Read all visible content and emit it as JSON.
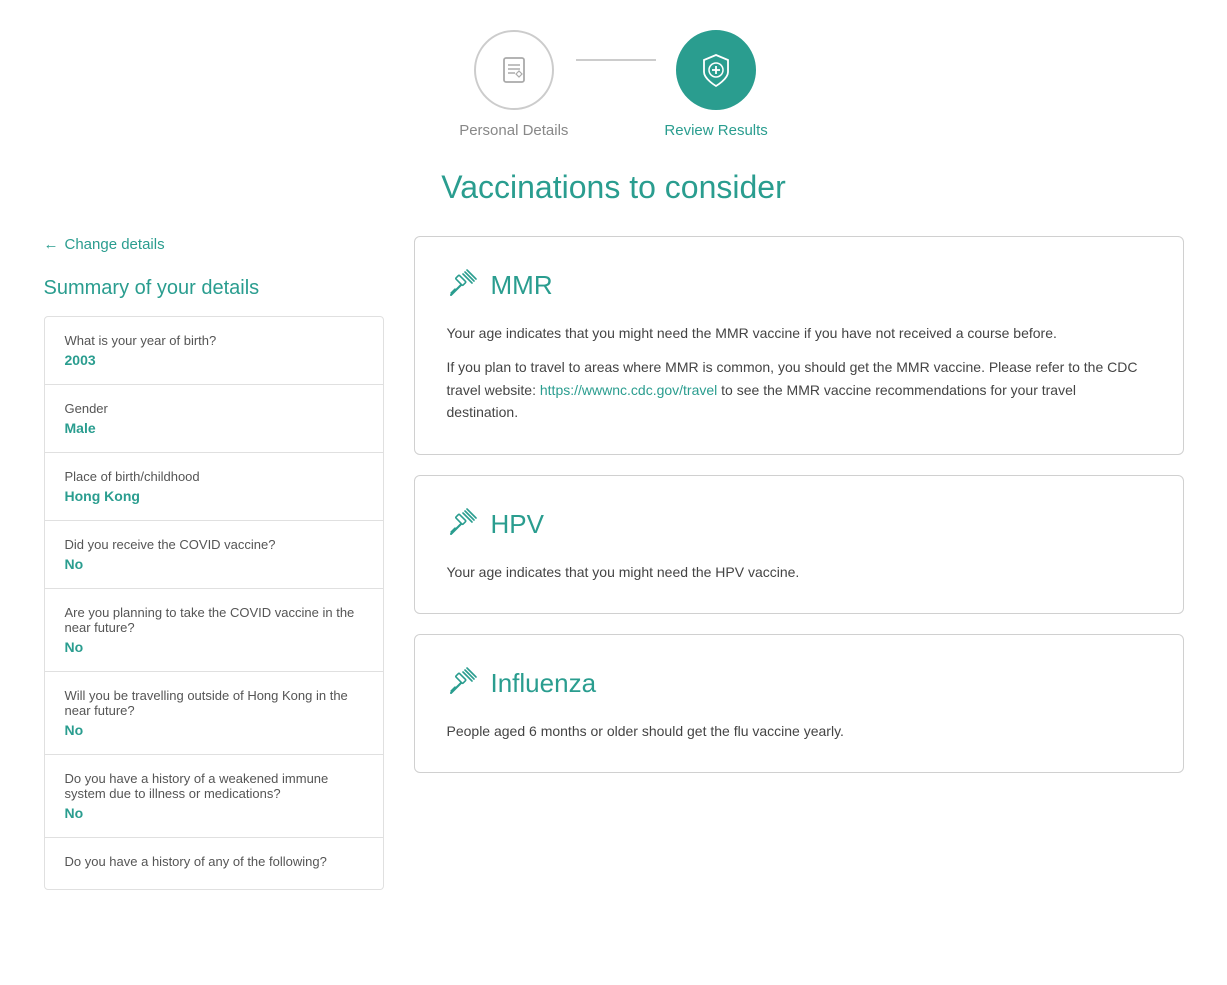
{
  "stepper": {
    "steps": [
      {
        "id": "personal-details",
        "label": "Personal Details",
        "active": false
      },
      {
        "id": "review-results",
        "label": "Review Results",
        "active": true
      }
    ]
  },
  "page": {
    "title": "Vaccinations to consider",
    "change_details_label": "Change details"
  },
  "sidebar": {
    "summary_title": "Summary of your details",
    "items": [
      {
        "question": "What is your year of birth?",
        "answer": "2003"
      },
      {
        "question": "Gender",
        "answer": "Male"
      },
      {
        "question": "Place of birth/childhood",
        "answer": "Hong Kong"
      },
      {
        "question": "Did you receive the COVID vaccine?",
        "answer": "No"
      },
      {
        "question": "Are you planning to take the COVID vaccine in the near future?",
        "answer": "No"
      },
      {
        "question": "Will you be travelling outside of Hong Kong in the near future?",
        "answer": "No"
      },
      {
        "question": "Do you have a history of a weakened immune system due to illness or medications?",
        "answer": "No"
      },
      {
        "question": "Do you have a history of any of the following?",
        "answer": ""
      }
    ]
  },
  "vaccines": [
    {
      "id": "mmr",
      "name": "MMR",
      "paragraphs": [
        "Your age indicates that you might need the MMR vaccine if you have not received a course before.",
        "If you plan to travel to areas where MMR is common, you should get the MMR vaccine. Please refer to the CDC travel website: {link} to see the MMR vaccine recommendations for your travel destination."
      ],
      "link_text": "https://wwwnc.cdc.gov/travel",
      "link_href": "https://wwwnc.cdc.gov/travel",
      "link_placeholder": "{link}"
    },
    {
      "id": "hpv",
      "name": "HPV",
      "paragraphs": [
        "Your age indicates that you might need the HPV vaccine."
      ],
      "link_text": null
    },
    {
      "id": "influenza",
      "name": "Influenza",
      "paragraphs": [
        "People aged 6 months or older should get the flu vaccine yearly."
      ],
      "link_text": null
    }
  ],
  "colors": {
    "teal": "#2a9d8f",
    "light_gray": "#888",
    "border": "#d0d0d0"
  }
}
